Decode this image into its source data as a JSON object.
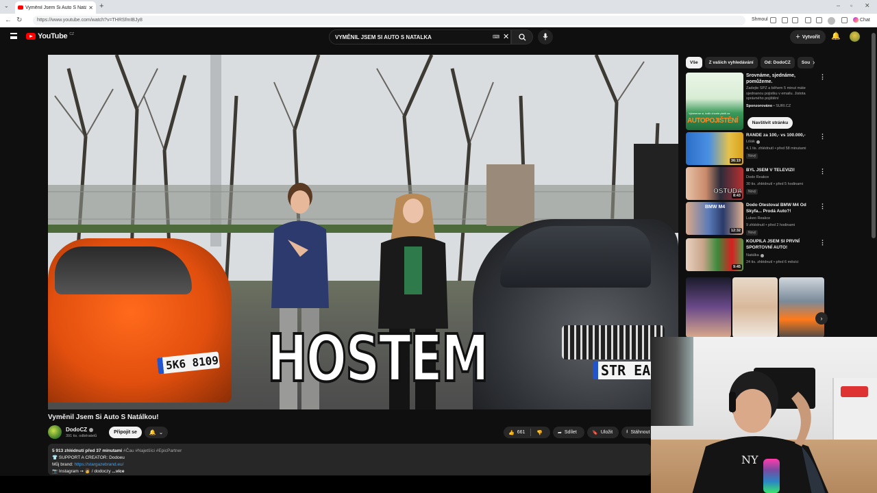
{
  "browser": {
    "tab_title": "Vyměnil Jsem Si Auto S Natálkou!",
    "tab_close": "✕",
    "new_tab": "+",
    "url": "https://www.youtube.com/watch?v=THRSfmIBJy8",
    "profile_label": "Shmoul",
    "chat_label": "Chat"
  },
  "header": {
    "logo_text": "YouTube",
    "logo_country": "CZ",
    "search_value": "VYMĚNIL JSEM SI AUTO S NATALKA",
    "create_label": "Vytvořit"
  },
  "video": {
    "overlay_text": "HOSTEM",
    "plate_left": "5K6 8109",
    "plate_right": "STR EAM",
    "title": "Vyměnil Jsem Si Auto S Natálkou!",
    "channel": "DodoCZ",
    "subscribers": "391 tis. odběratelů",
    "join_label": "Připojit se",
    "likes": "661",
    "share_label": "Sdílet",
    "save_label": "Uložit",
    "download_label": "Stáhnout",
    "description": {
      "meta": "5 913 zhlédnutí  před 37 minutami",
      "tags": "#Čau #Najetšíci #EpicPartner",
      "line1": "👕 SUPPORT A CREATOR: Dodoeu",
      "brand_label": "Můj brand: ",
      "brand_link": "https://stargazebrand.eu/",
      "line3": "📷 Instagram ➙ 👩 / dodoczy",
      "more": "...více"
    }
  },
  "sidebar": {
    "chips": [
      "Vše",
      "Z vašich vyhledávání",
      "Od: DodoCZ",
      "Sou"
    ],
    "ad": {
      "title": "Srovnáme, sjednáme, pomůžeme.",
      "desc": "Zadejte SPZ a během 5 minut máte sjednanou pojistku v emailu. Jistota správného pojištění",
      "sponsor_label": "Sponzorováno",
      "sponsor_domain": "SURI.CZ",
      "button": "Navštívit stránku",
      "thumb_brand_1": "AUTO",
      "thumb_brand_2": "POJIŠTĚNÍ",
      "thumb_small": "Vybereme si, kolik chcete platit za"
    },
    "recommendations": [
      {
        "title": "RANDE za 100,- vs 100.000,-",
        "channel": "Lišák",
        "stats": "4,1 tis. zhlédnutí • před 58 minutami",
        "badge": "Nový",
        "duration": "36:19"
      },
      {
        "title": "BYL JSEM V TELEVIZI!",
        "channel": "Dodo Reakce",
        "stats": "30 tis. zhlédnutí • před 5 hodinami",
        "badge": "Nový",
        "duration": "8:43"
      },
      {
        "title": "Dodo Otestoval BMW M4 Od Skyfa... Prodá Auto?!",
        "channel": "Lukeo Reakce",
        "stats": "9 zhlédnutí • před 2 hodinami",
        "badge": "Nový",
        "duration": "12:32"
      },
      {
        "title": "KOUPILA JSEM SI PRVNÍ SPORTOVNÍ AUTO!",
        "channel": "Natálka",
        "stats": "24 tis. zhlédnutí • před 6 měsíci",
        "badge": "",
        "duration": "9:45"
      }
    ],
    "thumb_texts": {
      "rec2": "OSTUDA",
      "rec3": "BMW M4"
    }
  }
}
